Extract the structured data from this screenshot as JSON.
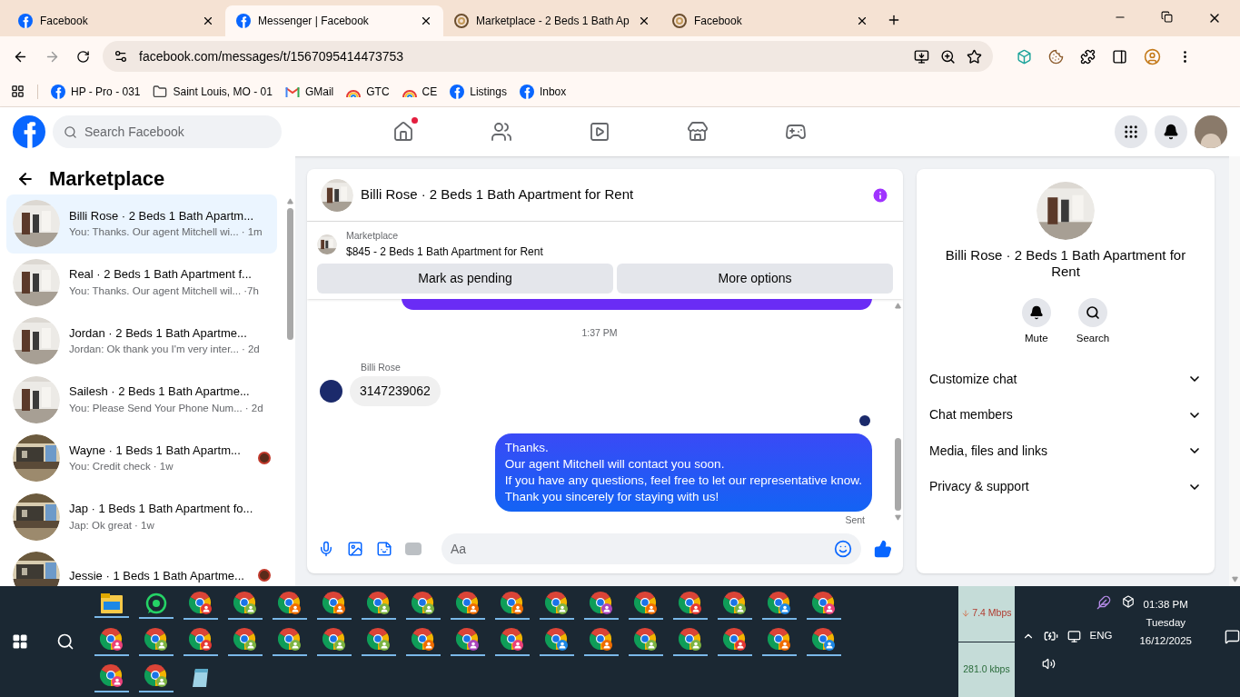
{
  "browser": {
    "tabs": [
      {
        "title": "Facebook",
        "kind": "facebook",
        "selected": false
      },
      {
        "title": "Messenger | Facebook",
        "kind": "facebook",
        "selected": true
      },
      {
        "title": "Marketplace - 2 Beds 1 Bath Ap",
        "kind": "swirl",
        "selected": false
      },
      {
        "title": "Facebook",
        "kind": "swirl",
        "selected": false
      }
    ],
    "url": "facebook.com/messages/t/1567095414473753",
    "bookmarks": [
      {
        "label": "HP - Pro - 031",
        "kind": "facebook"
      },
      {
        "label": "Saint Louis, MO - 01",
        "kind": "folder"
      },
      {
        "label": "GMail",
        "kind": "gmail"
      },
      {
        "label": "GTC",
        "kind": "rainbow"
      },
      {
        "label": "CE",
        "kind": "rainbow"
      },
      {
        "label": "Listings",
        "kind": "facebook"
      },
      {
        "label": "Inbox",
        "kind": "facebook"
      }
    ]
  },
  "header": {
    "search": {
      "placeholder": "Search Facebook"
    },
    "nav": [
      {
        "kind": "home",
        "badge": true
      },
      {
        "kind": "friends",
        "badge": false
      },
      {
        "kind": "video",
        "badge": false
      },
      {
        "kind": "marketplace",
        "badge": false
      },
      {
        "kind": "gaming",
        "badge": false
      }
    ]
  },
  "sidebar": {
    "title": "Marketplace",
    "conversations": [
      {
        "name": "Billi Rose · 2 Beds 1 Bath Apartm...",
        "preview": "You: Thanks. Our agent Mitchell wi...",
        "time": "· 1m",
        "selected": true,
        "seen": false
      },
      {
        "name": "Real · 2 Beds 1 Bath Apartment f...",
        "preview": "You: Thanks. Our agent Mitchell wil...",
        "time": "·7h",
        "selected": false,
        "seen": false
      },
      {
        "name": "Jordan · 2 Beds 1 Bath Apartme...",
        "preview": "Jordan: Ok thank you I'm very inter...",
        "time": "· 2d",
        "selected": false,
        "seen": false
      },
      {
        "name": "Sailesh · 2 Beds 1 Bath Apartme...",
        "preview": "You: Please Send Your Phone Num...",
        "time": "· 2d",
        "selected": false,
        "seen": false
      },
      {
        "name": "Wayne · 1 Beds 1 Bath Apartm...",
        "preview": "You: Credit check",
        "time": "· 1w",
        "selected": false,
        "seen": true
      },
      {
        "name": "Jap · 1 Beds 1 Bath Apartment fo...",
        "preview": "Jap: Ok great",
        "time": "· 1w",
        "selected": false,
        "seen": false
      },
      {
        "name": "Jessie · 1 Beds 1 Bath Apartme...",
        "selected": false,
        "seen": true
      }
    ]
  },
  "chat": {
    "title": "Billi Rose · 2 Beds 1 Bath Apartment for Rent",
    "listing": {
      "label": "Marketplace",
      "title": "$845 - 2 Beds 1 Bath Apartment for Rent"
    },
    "buttons": [
      "Mark as pending",
      "More options"
    ],
    "messages": [
      {
        "kind": "time",
        "text": "1:37 PM"
      },
      {
        "kind": "incoming",
        "sender": "Billi Rose",
        "text": "3147239062"
      },
      {
        "kind": "outgoing",
        "lines": [
          "Thanks.",
          "Our agent Mitchell will contact you soon.",
          "If you have any questions, feel free to let our representative know.",
          "Thank you sincerely for staying with us!"
        ],
        "status": "Sent"
      }
    ],
    "composer": {
      "placeholder": "Aa"
    }
  },
  "details": {
    "title": "Billi Rose · 2 Beds 1 Bath Apartment for Rent",
    "actions": [
      {
        "label": "Mute",
        "kind": "bell"
      },
      {
        "label": "Search",
        "kind": "search"
      }
    ],
    "sections": [
      "Customize chat",
      "Chat members",
      "Media, files and links",
      "Privacy & support"
    ]
  },
  "taskbar": {
    "apps": [
      {
        "kind": "explorer"
      },
      {
        "kind": "whatsapp"
      },
      {
        "kind": "chrome",
        "color": "#e53935"
      },
      {
        "kind": "chrome",
        "color": "#7cb342"
      },
      {
        "kind": "chrome",
        "color": "#ef6c00"
      },
      {
        "kind": "chrome",
        "color": "#ef6c00"
      },
      {
        "kind": "chrome",
        "color": "#7cb342"
      },
      {
        "kind": "chrome",
        "color": "#7cb342"
      },
      {
        "kind": "chrome",
        "color": "#ef6c00"
      },
      {
        "kind": "chrome",
        "color": "#ef6c00"
      },
      {
        "kind": "chrome",
        "color": "#7cb342"
      },
      {
        "kind": "chrome",
        "color": "#ab47bc"
      },
      {
        "kind": "chrome",
        "color": "#ef6c00"
      },
      {
        "kind": "chrome",
        "color": "#e53935"
      },
      {
        "kind": "chrome",
        "color": "#7cb342"
      },
      {
        "kind": "chrome",
        "color": "#1e88e5"
      },
      {
        "kind": "chrome",
        "color": "#ec407a"
      },
      {
        "kind": "chrome",
        "color": "#ec407a"
      },
      {
        "kind": "chrome",
        "color": "#7cb342"
      },
      {
        "kind": "chrome",
        "color": "#e53935"
      },
      {
        "kind": "chrome",
        "color": "#7cb342"
      },
      {
        "kind": "chrome",
        "color": "#7cb342"
      },
      {
        "kind": "chrome",
        "color": "#7cb342"
      },
      {
        "kind": "chrome",
        "color": "#7cb342"
      },
      {
        "kind": "chrome",
        "color": "#ef6c00"
      },
      {
        "kind": "chrome",
        "color": "#ab47bc"
      },
      {
        "kind": "chrome",
        "color": "#ec407a"
      },
      {
        "kind": "chrome",
        "color": "#1e88e5"
      },
      {
        "kind": "chrome",
        "color": "#ef6c00"
      },
      {
        "kind": "chrome",
        "color": "#7cb342"
      },
      {
        "kind": "chrome",
        "color": "#7cb342"
      },
      {
        "kind": "chrome",
        "color": "#e53935"
      },
      {
        "kind": "chrome",
        "color": "#ef6c00"
      },
      {
        "kind": "chrome",
        "color": "#1e88e5"
      },
      {
        "kind": "chrome",
        "color": "#ec407a"
      },
      {
        "kind": "chrome",
        "color": "#7cb342"
      },
      {
        "kind": "notes"
      }
    ],
    "download": "7.4 Mbps",
    "upload": "281.0 kbps",
    "language": "ENG",
    "time": "01:38 PM",
    "day": "Tuesday",
    "date": "16/12/2025"
  }
}
